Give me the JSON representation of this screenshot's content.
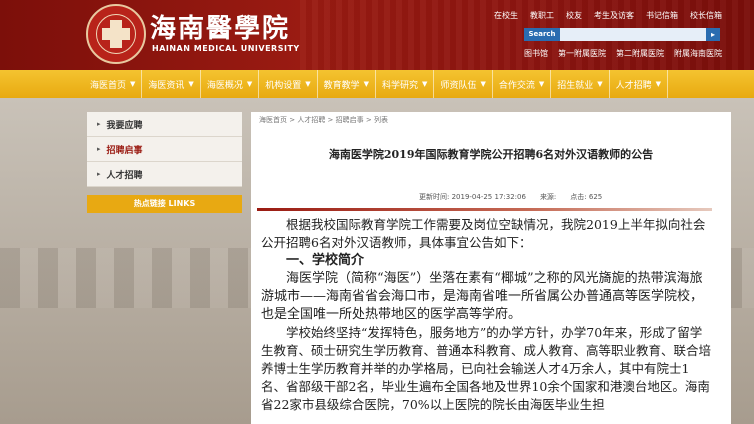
{
  "header": {
    "brand_cn": "海南醫學院",
    "brand_en": "HAINAN MEDICAL UNIVERSITY",
    "top_links": [
      "在校生",
      "教职工",
      "校友",
      "考生及访客",
      "书记信箱",
      "校长信箱"
    ],
    "search_label": "Search",
    "search_value": "",
    "sub_links": [
      "图书馆",
      "第一附属医院",
      "第二附属医院",
      "附属海南医院"
    ]
  },
  "nav": {
    "items": [
      "海医首页",
      "海医资讯",
      "海医概况",
      "机构设置",
      "教育教学",
      "科学研究",
      "师资队伍",
      "合作交流",
      "招生就业",
      "人才招聘"
    ]
  },
  "sidebar": {
    "items": [
      "我要应聘",
      "招聘启事",
      "人才招聘"
    ],
    "hot_link": "热点链接 LINKS"
  },
  "article": {
    "breadcrumb": "海医首页 > 人才招聘 > 招聘启事 > 列表",
    "title": "海南医学院2019年国际教育学院公开招聘6名对外汉语教师的公告",
    "update_time": "更新时间: 2019-04-25 17:32:06",
    "source": "来源:",
    "hits": "点击: 625",
    "intro": "根据我校国际教育学院工作需要及岗位空缺情况，我院2019上半年拟向社会公开招聘6名对外汉语教师，具体事宜公告如下：",
    "section1": "一、学校简介",
    "para1": "海医学院（简称“海医”）坐落在素有“椰城”之称的风光旖旎的热带滨海旅游城市——海南省省会海口市，是海南省唯一所省属公办普通高等医学院校，也是全国唯一所处热带地区的医学高等学府。",
    "para2": "学校始终坚持“发挥特色，服务地方”的办学方针，办学70年来，形成了留学生教育、硕士研究生学历教育、普通本科教育、成人教育、高等职业教育、联合培养博士生学历教育并举的办学格局，已向社会输送人才4万余人，其中有院士1名、省部级干部2名，毕业生遍布全国各地及世界10余个国家和港澳台地区。海南省22家市县级综合医院，70%以上医院的院长由海医毕业生担"
  }
}
